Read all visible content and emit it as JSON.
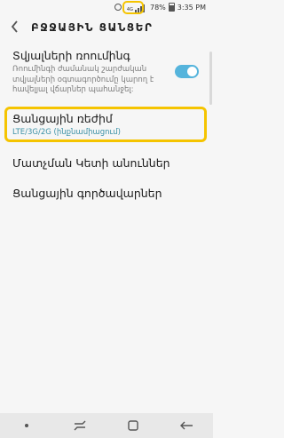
{
  "status_bar": {
    "network_type": "4G",
    "battery_percent": "78%",
    "time": "3:35 PM"
  },
  "header": {
    "title": "ԲՋՋԱՅԻՆ ՑԱՆՑԵՐ"
  },
  "settings": [
    {
      "title": "Տվյալների ռոումինգ",
      "description": "Ռոումինգի ժամանակ շարժական տվյալների օգտագործումը կարող է հավելյալ վճարներ պահանջել:",
      "toggle_on": true
    },
    {
      "title": "Ցանցային ռեժիմ",
      "value": "LTE/3G/2G (ինքնամիացում)"
    },
    {
      "title": "Մատչման Կետի անուններ"
    },
    {
      "title": "Ցանցային գործավարներ"
    }
  ],
  "colors": {
    "accent": "#55b4dc",
    "value_text": "#3b91a6",
    "highlight": "#f5c400",
    "background": "#f6f6f6"
  },
  "icons": {
    "back": "chevron-left-icon",
    "alarm": "alarm-icon",
    "signal": "signal-icon",
    "battery": "battery-icon",
    "nav_menu": "nav-dot-icon",
    "nav_recent": "recent-apps-icon",
    "nav_home": "home-icon",
    "nav_back": "back-arrow-icon"
  }
}
